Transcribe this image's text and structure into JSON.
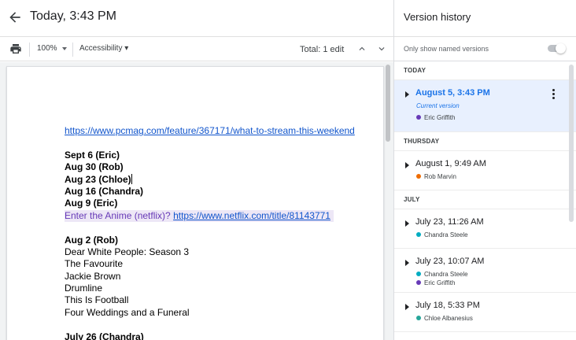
{
  "header": {
    "title": "Today, 3:43 PM"
  },
  "toolbar": {
    "zoom": "100%",
    "accessibility": "Accessibility",
    "total_edits": "Total: 1 edit"
  },
  "document": {
    "lines": [
      {
        "text": "https://www.pcmag.com/feature/367171/what-to-stream-this-weekend",
        "style": "link"
      },
      {
        "text": "",
        "style": "gap"
      },
      {
        "text": "Sept 6 (Eric)",
        "style": "bold"
      },
      {
        "text": "Aug 30 (Rob)",
        "style": "bold"
      },
      {
        "text": "Aug 23 (Chloe)",
        "style": "bold-cursor"
      },
      {
        "text": "Aug 16 (Chandra)",
        "style": "bold"
      },
      {
        "text": "Aug 9 (Eric)",
        "style": "bold"
      },
      {
        "text": "Enter the Anime (netflix)? ",
        "link": "https://www.netflix.com/title/81143771",
        "style": "highlight"
      },
      {
        "text": "",
        "style": "gap"
      },
      {
        "text": "Aug 2 (Rob)",
        "style": "bold"
      },
      {
        "text": "Dear White People: Season 3",
        "style": "normal"
      },
      {
        "text": "The Favourite",
        "style": "normal"
      },
      {
        "text": "Jackie Brown",
        "style": "normal"
      },
      {
        "text": "Drumline",
        "style": "normal"
      },
      {
        "text": "This Is Football",
        "style": "normal"
      },
      {
        "text": "Four Weddings and a Funeral",
        "style": "normal"
      },
      {
        "text": "",
        "style": "gap"
      },
      {
        "text": "July 26 (Chandra)",
        "style": "bold"
      }
    ]
  },
  "version_history": {
    "title": "Version history",
    "named_toggle_label": "Only show named versions",
    "named_toggle_on": false,
    "sections": [
      {
        "label": "TODAY",
        "entries": [
          {
            "date": "August 5, 3:43 PM",
            "current": "Current version",
            "selected": true,
            "authors": [
              {
                "name": "Eric Griffith",
                "color": "#673ab7"
              }
            ]
          }
        ]
      },
      {
        "label": "THURSDAY",
        "entries": [
          {
            "date": "August 1, 9:49 AM",
            "authors": [
              {
                "name": "Rob Marvin",
                "color": "#ef6c00"
              }
            ]
          }
        ]
      },
      {
        "label": "JULY",
        "entries": [
          {
            "date": "July 23, 11:26 AM",
            "authors": [
              {
                "name": "Chandra Steele",
                "color": "#00acc1"
              }
            ]
          },
          {
            "date": "July 23, 10:07 AM",
            "authors": [
              {
                "name": "Chandra Steele",
                "color": "#00acc1"
              },
              {
                "name": "Eric Griffith",
                "color": "#673ab7"
              }
            ]
          },
          {
            "date": "July 18, 5:33 PM",
            "authors": [
              {
                "name": "Chloe Albanesius",
                "color": "#26a69a"
              }
            ]
          }
        ]
      }
    ]
  },
  "icons": {
    "back": "arrow-back-icon",
    "print": "print-icon",
    "up": "chevron-up-icon",
    "down": "chevron-down-icon",
    "more": "more-vert-icon"
  }
}
